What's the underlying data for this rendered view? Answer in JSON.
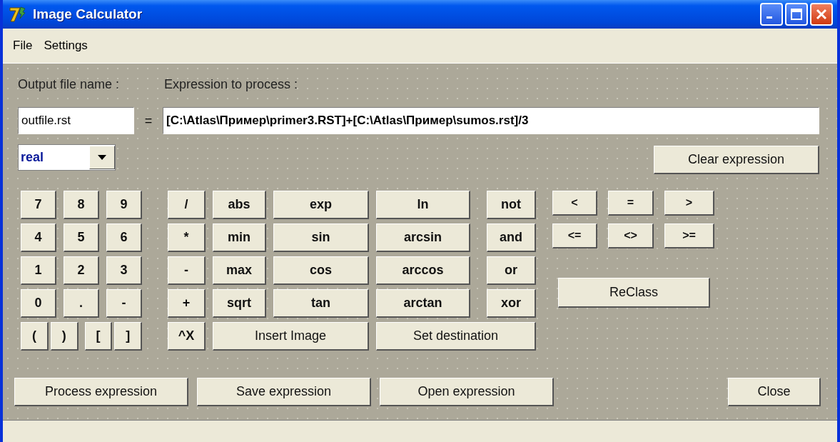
{
  "window": {
    "title": "Image Calculator"
  },
  "menu": [
    {
      "label": "File"
    },
    {
      "label": "Settings"
    }
  ],
  "labels": {
    "output": "Output file name :",
    "expression": "Expression to process :"
  },
  "output_file": {
    "value": "outfile.rst"
  },
  "equals": "=",
  "expression": {
    "value": "[C:\\Atlas\\Пример\\primer3.RST]+[C:\\Atlas\\Пример\\sumos.rst]/3"
  },
  "data_type": {
    "value": "real"
  },
  "clear_button": "Clear expression",
  "keypad": {
    "digits": [
      "7",
      "8",
      "9",
      "4",
      "5",
      "6",
      "1",
      "2",
      "3",
      "0",
      ".",
      "-"
    ],
    "brackets": [
      "(",
      ")",
      "[",
      "]"
    ],
    "operators": [
      "/",
      "*",
      "-",
      "+",
      "^X"
    ],
    "functions_a": [
      "abs",
      "min",
      "max",
      "sqrt"
    ],
    "functions_b": [
      "exp",
      "sin",
      "cos",
      "tan"
    ],
    "functions_c": [
      "ln",
      "arcsin",
      "arccos",
      "arctan"
    ],
    "logic": [
      "not",
      "and",
      "or",
      "xor"
    ],
    "insert_image": "Insert Image",
    "set_destination": "Set destination"
  },
  "comparisons": [
    "<",
    "=",
    ">",
    "<=",
    "<>",
    ">="
  ],
  "reclass_button": "ReClass",
  "bottom_buttons": [
    "Process expression",
    "Save expression",
    "Open expression"
  ],
  "close_button": "Close"
}
